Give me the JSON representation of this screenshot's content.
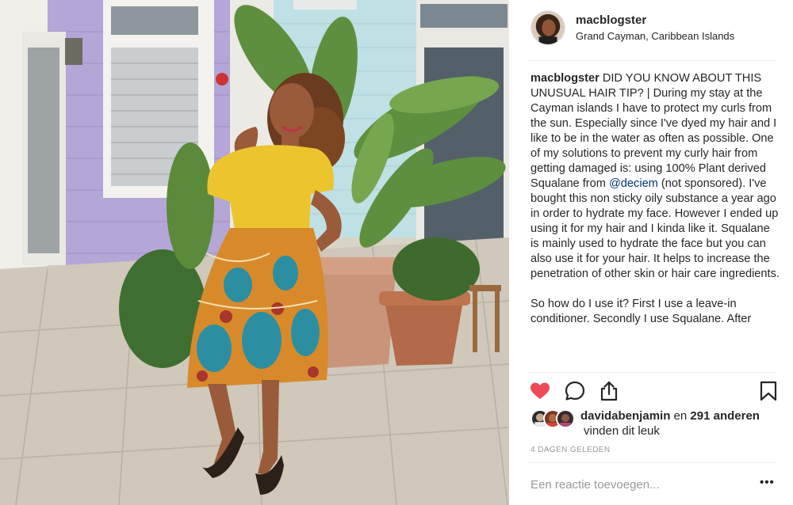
{
  "post": {
    "author": {
      "username": "macblogster",
      "location": "Grand Cayman, Caribbean Islands"
    },
    "caption": {
      "username": "macblogster",
      "paragraph1_before_mention": " DID YOU KNOW ABOUT THIS UNUSUAL HAIR TIP? | During my stay at the Cayman islands I have to protect my curls from the sun. Especially since I've dyed my hair and I like to be in the water as often as possible. One of my solutions to prevent my curly hair from getting damaged is: using 100% Plant derived Squalane from ",
      "mention": "@deciem",
      "paragraph1_after_mention": " (not sponsored). I've bought this non sticky oily substance a year ago in order to hydrate my face. However I ended up using it for my hair and I kinda like it. Squalane is mainly used to hydrate the face but you can also use it for your hair. It helps to increase the penetration of other skin or hair care ingredients.",
      "paragraph2": "So how do I use it? First I use a leave-in conditioner. Secondly I use Squalane. After"
    },
    "actions": {
      "like_icon": "heart-filled-icon",
      "comment_icon": "comment-icon",
      "share_icon": "share-icon",
      "save_icon": "bookmark-icon",
      "liked": true,
      "like_color": "#ed4956"
    },
    "likes": {
      "first_user": "davidabenjamin",
      "connector": " en ",
      "others_count": "291 anderen",
      "line2": "vinden dit leuk"
    },
    "timestamp": "4 DAGEN GELEDEN",
    "comment": {
      "placeholder": "Een reactie toevoegen...",
      "more_label": "•••"
    }
  }
}
